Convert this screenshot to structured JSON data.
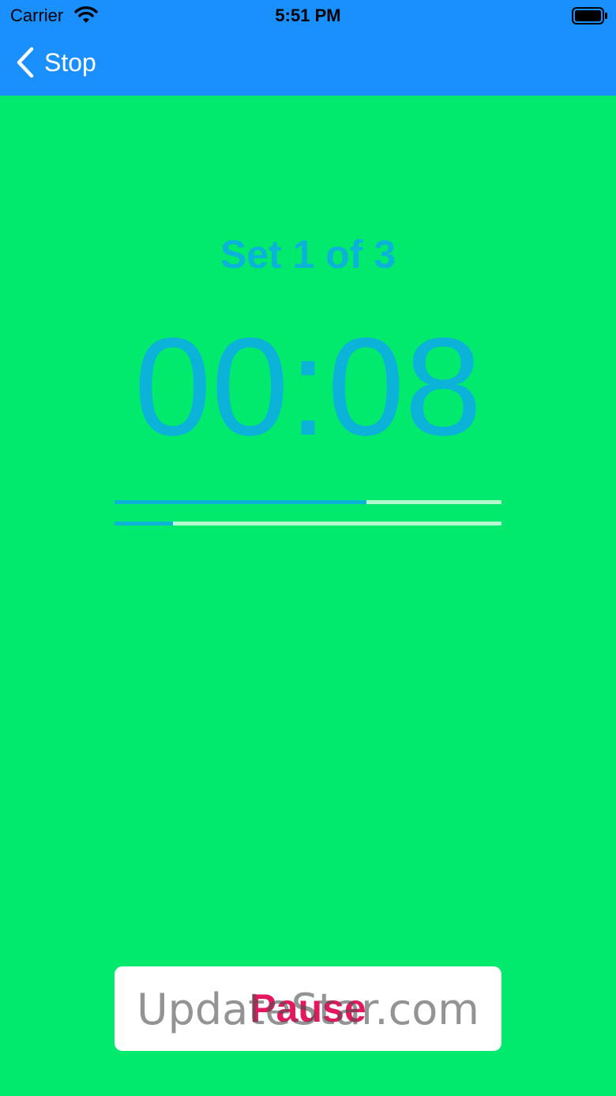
{
  "status_bar": {
    "carrier": "Carrier",
    "time": "5:51 PM",
    "wifi_icon": "wifi-icon",
    "battery_icon": "battery-icon"
  },
  "nav": {
    "back_icon": "chevron-left-icon",
    "back_label": "Stop"
  },
  "workout": {
    "set_label": "Set 1 of 3",
    "timer": "00:08",
    "progress_set_fraction": 0.65,
    "progress_total_fraction": 0.15
  },
  "actions": {
    "pause_label": "Pause"
  },
  "watermark": {
    "text": "UpdateStar.com"
  },
  "colors": {
    "header": "#1A90FF",
    "background": "#02EA6E",
    "accent": "#0BB3D8",
    "track": "#B6F8D2",
    "pause_text": "#E4185F"
  }
}
